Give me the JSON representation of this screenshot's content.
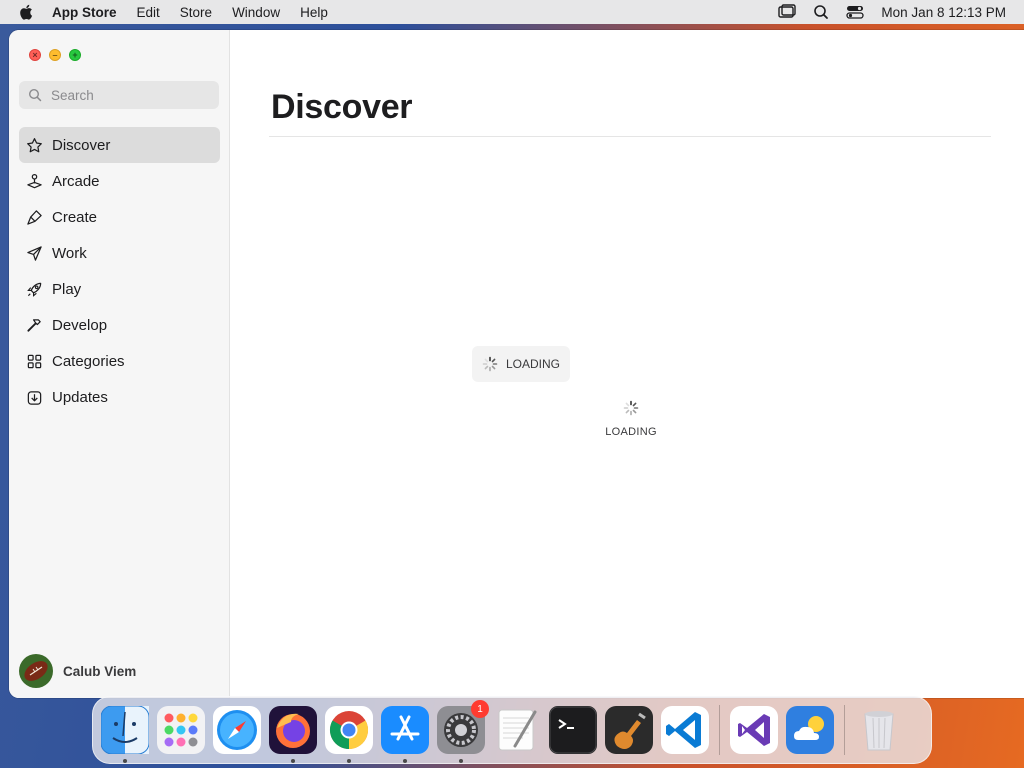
{
  "menubar": {
    "app_name": "App Store",
    "menus": [
      "Edit",
      "Store",
      "Window",
      "Help"
    ],
    "clock": "Mon Jan 8  12:13 PM",
    "status_icons": [
      "screen-mirroring-icon",
      "spotlight-search-icon",
      "control-center-icon"
    ]
  },
  "window": {
    "traffic_lights": {
      "close": "close-button",
      "minimize": "minimize-button",
      "zoom": "zoom-button"
    }
  },
  "sidebar": {
    "search_placeholder": "Search",
    "items": [
      {
        "label": "Discover",
        "icon": "star-icon",
        "active": true
      },
      {
        "label": "Arcade",
        "icon": "joystick-icon",
        "active": false
      },
      {
        "label": "Create",
        "icon": "brush-icon",
        "active": false
      },
      {
        "label": "Work",
        "icon": "paper-plane-icon",
        "active": false
      },
      {
        "label": "Play",
        "icon": "rocket-icon",
        "active": false
      },
      {
        "label": "Develop",
        "icon": "hammer-icon",
        "active": false
      },
      {
        "label": "Categories",
        "icon": "grid-icon",
        "active": false
      },
      {
        "label": "Updates",
        "icon": "download-icon",
        "active": false
      }
    ],
    "user_name": "Calub Viem"
  },
  "main": {
    "title": "Discover",
    "loading_primary": "LOADING",
    "loading_secondary": "LOADING"
  },
  "dock": {
    "apps": [
      {
        "name": "Finder",
        "running": true
      },
      {
        "name": "Launchpad",
        "running": false
      },
      {
        "name": "Safari",
        "running": false
      },
      {
        "name": "Firefox",
        "running": true
      },
      {
        "name": "Chrome",
        "running": true
      },
      {
        "name": "App Store",
        "running": true
      },
      {
        "name": "System Settings",
        "running": true,
        "badge": "1"
      },
      {
        "name": "TextEdit",
        "running": false
      },
      {
        "name": "Terminal",
        "running": false
      },
      {
        "name": "GarageBand",
        "running": false
      },
      {
        "name": "Visual Studio Code",
        "running": false
      },
      {
        "name": "Visual Studio",
        "running": false
      },
      {
        "name": "Weather",
        "running": false
      },
      {
        "name": "Trash",
        "running": false
      }
    ]
  },
  "colors": {
    "accent_close": "#ff5f57",
    "accent_minimize": "#febc2e",
    "accent_zoom": "#28c840",
    "sidebar_active": "#dcdcdc",
    "badge": "#ff3b30"
  }
}
